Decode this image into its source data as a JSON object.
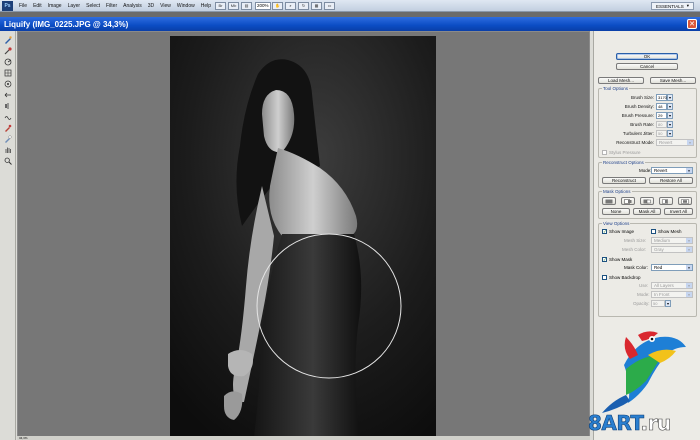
{
  "menubar": {
    "logo": "Ps",
    "items": [
      "File",
      "Edit",
      "Image",
      "Layer",
      "Select",
      "Filter",
      "Analysis",
      "3D",
      "View",
      "Window",
      "Help"
    ],
    "zoom": "200%",
    "workspace": "ESSENTIALS"
  },
  "dialog": {
    "title": "Liquify (IMG_0225.JPG @ 34,3%)",
    "close_glyph": "✕"
  },
  "panel": {
    "ok_label": "OK",
    "cancel_label": "Cancel",
    "load_mesh_label": "Load Mesh...",
    "save_mesh_label": "Save Mesh...",
    "tool_options": {
      "title": "Tool Options",
      "brush_size_label": "Brush Size:",
      "brush_size_value": "3170",
      "brush_density_label": "Brush Density:",
      "brush_density_value": "48",
      "brush_pressure_label": "Brush Pressure:",
      "brush_pressure_value": "29",
      "brush_rate_label": "Brush Rate:",
      "brush_rate_value": "80",
      "turbulent_jitter_label": "Turbulent Jitter:",
      "turbulent_jitter_value": "50",
      "reconstruct_mode_label": "Reconstruct Mode:",
      "reconstruct_mode_value": "Revert",
      "stylus_pressure_label": "Stylus Pressure"
    },
    "reconstruct_options": {
      "title": "Reconstruct Options",
      "mode_label": "Mode:",
      "mode_value": "Revert",
      "reconstruct_label": "Reconstruct",
      "restore_all_label": "Restore All"
    },
    "mask_options": {
      "title": "Mask Options",
      "none_label": "None",
      "mask_all_label": "Mask All",
      "invert_all_label": "Invert All"
    },
    "view_options": {
      "title": "View Options",
      "show_image_label": "Show Image",
      "show_mesh_label": "Show Mesh",
      "mesh_size_label": "Mesh Size:",
      "mesh_size_value": "Medium",
      "mesh_color_label": "Mesh Color:",
      "mesh_color_value": "Gray",
      "show_mask_label": "Show Mask",
      "mask_color_label": "Mask Color:",
      "mask_color_value": "Red",
      "show_backdrop_label": "Show Backdrop",
      "use_label": "Use:",
      "use_value": "All Layers",
      "mode_label": "Mode:",
      "mode_value": "In Front",
      "opacity_label": "Opacity:",
      "opacity_value": "50"
    }
  },
  "statusbar": {
    "zoom_text": "34,3%"
  },
  "watermark": {
    "text_part1": "8ART",
    "text_part2": ".ru",
    "color1": "#2a7fd0",
    "color2": "#ffffff"
  }
}
